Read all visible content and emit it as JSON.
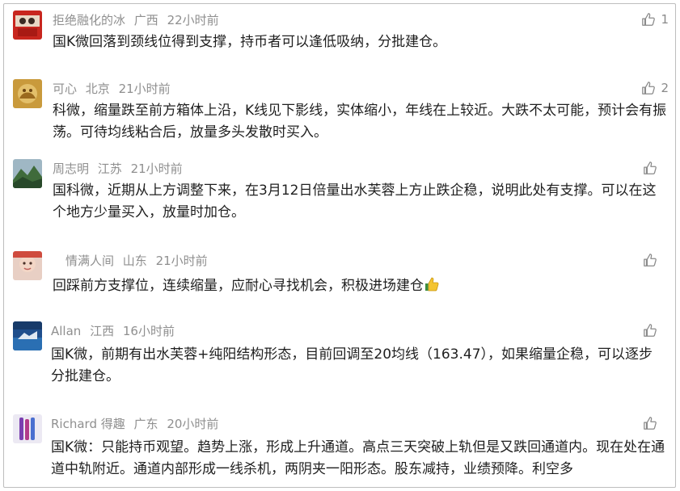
{
  "comments": [
    {
      "user": "拒绝融化的冰",
      "location": "广西",
      "time": "22小时前",
      "text": "国K微回落到颈线位得到支撑，持币者可以逢低吸纳，分批建仓。",
      "likes": "1",
      "avatar": "avatar-red"
    },
    {
      "user": "可心",
      "location": "北京",
      "time": "21小时前",
      "text": "科微，缩量跌至前方箱体上沿，K线见下影线，实体缩小，年线在上较近。大跌不太可能，预计会有振荡。可待均线粘合后，放量多头发散时买入。",
      "likes": "2",
      "avatar": "avatar-gold"
    },
    {
      "user": "周志明",
      "location": "江苏",
      "time": "21小时前",
      "text": "国科微，近期从上方调整下来，在3月12日倍量出水芙蓉上方止跌企稳，说明此处有支撑。可以在这个地方少量买入，放量时加仓。",
      "likes": "",
      "avatar": "avatar-mountain"
    },
    {
      "user": "情满人间",
      "location": "山东",
      "time": "21小时前",
      "text": "回踩前方支撑位，连续缩量，应耐心寻找机会，积极进场建仓",
      "likes": "",
      "avatar": "avatar-child",
      "emoji": "thumbs-up-emoji"
    },
    {
      "user": "Allan",
      "location": "江西",
      "time": "16小时前",
      "text": "国K微，前期有出水芙蓉+纯阳结构形态，目前回调至20均线（163.47），如果缩量企稳，可以逐步分批建仓。",
      "likes": "",
      "avatar": "avatar-ocean"
    },
    {
      "user": "Richard 得趣",
      "location": "广东",
      "time": "20小时前",
      "text": "国K微：只能持币观望。趋势上涨，形成上升通道。高点三天突破上轨但是又跌回通道内。现在处在通道中轨附近。通道内部形成一线杀机，两阴夹一阳形态。股东减持，业绩预降。利空多",
      "likes": "",
      "avatar": "avatar-purple"
    }
  ]
}
